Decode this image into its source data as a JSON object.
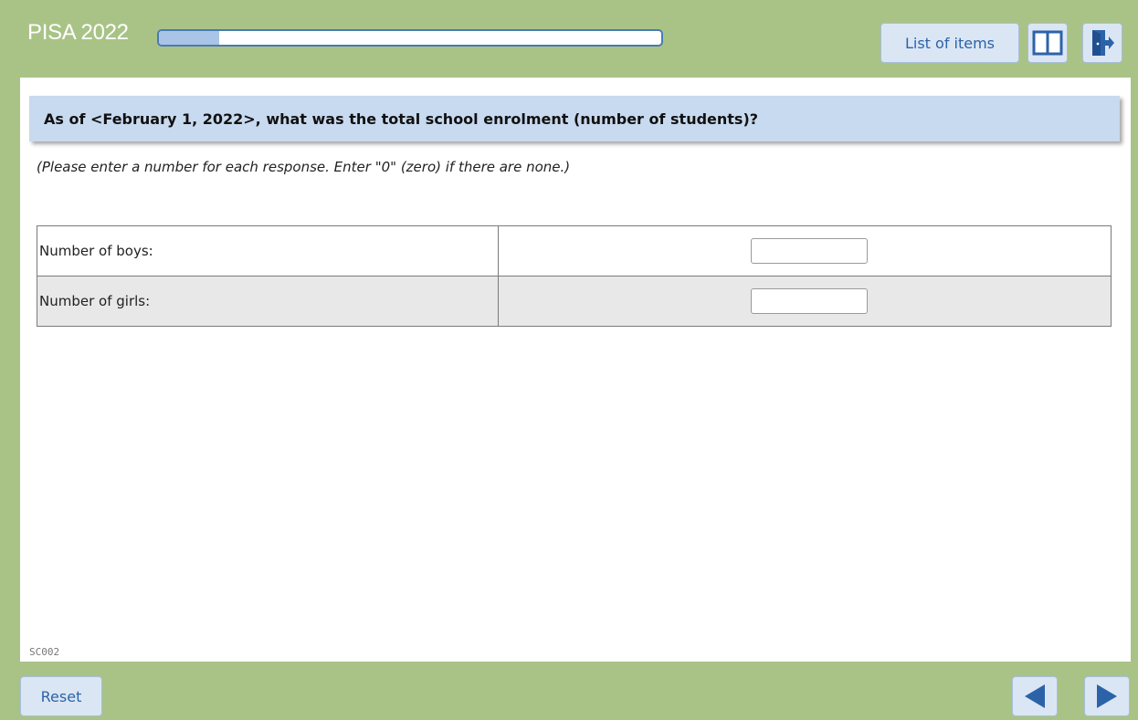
{
  "header": {
    "title": "PISA 2022",
    "progress_fraction": 0.12,
    "list_items_label": "List of items",
    "book_icon": "book-icon",
    "exit_icon": "exit-icon"
  },
  "question": {
    "text": "As of <February 1, 2022>, what was the total school enrolment (number of students)?",
    "instruction": "(Please enter a number for each response. Enter \"0\" (zero) if there are none.)",
    "rows": [
      {
        "label": "Number of boys:",
        "value": ""
      },
      {
        "label": "Number of girls:",
        "value": ""
      }
    ],
    "code": "SC002"
  },
  "footer": {
    "reset_label": "Reset",
    "prev_icon": "arrow-left-icon",
    "next_icon": "arrow-right-icon"
  },
  "colors": {
    "frame": "#a9c387",
    "accent": "#2c63a8",
    "button_bg": "#dbe6f4",
    "question_bg": "#c8daef"
  }
}
